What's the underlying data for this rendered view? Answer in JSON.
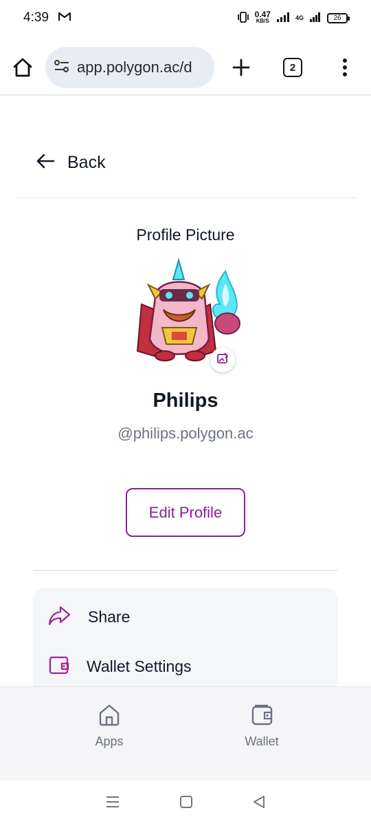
{
  "status_bar": {
    "time": "4:39",
    "net_speed_value": "0.47",
    "net_speed_unit": "KB/S",
    "network_type": "4G",
    "battery": "26"
  },
  "browser": {
    "url": "app.polygon.ac/d",
    "tab_count": "2"
  },
  "page": {
    "back_label": "Back",
    "profile_picture_title": "Profile Picture",
    "name": "Philips",
    "handle": "@philips.polygon.ac",
    "edit_profile_label": "Edit Profile",
    "menu": [
      {
        "label": "Share",
        "icon": "share-arrow-icon"
      },
      {
        "label": "Wallet Settings",
        "icon": "wallet-icon"
      }
    ]
  },
  "bottom_nav": [
    {
      "label": "Apps",
      "icon": "home-icon"
    },
    {
      "label": "Wallet",
      "icon": "wallet-icon"
    }
  ],
  "colors": {
    "accent": "#8b1f9b",
    "url_pill": "#e8edf5",
    "muted_text": "#6b7280"
  }
}
